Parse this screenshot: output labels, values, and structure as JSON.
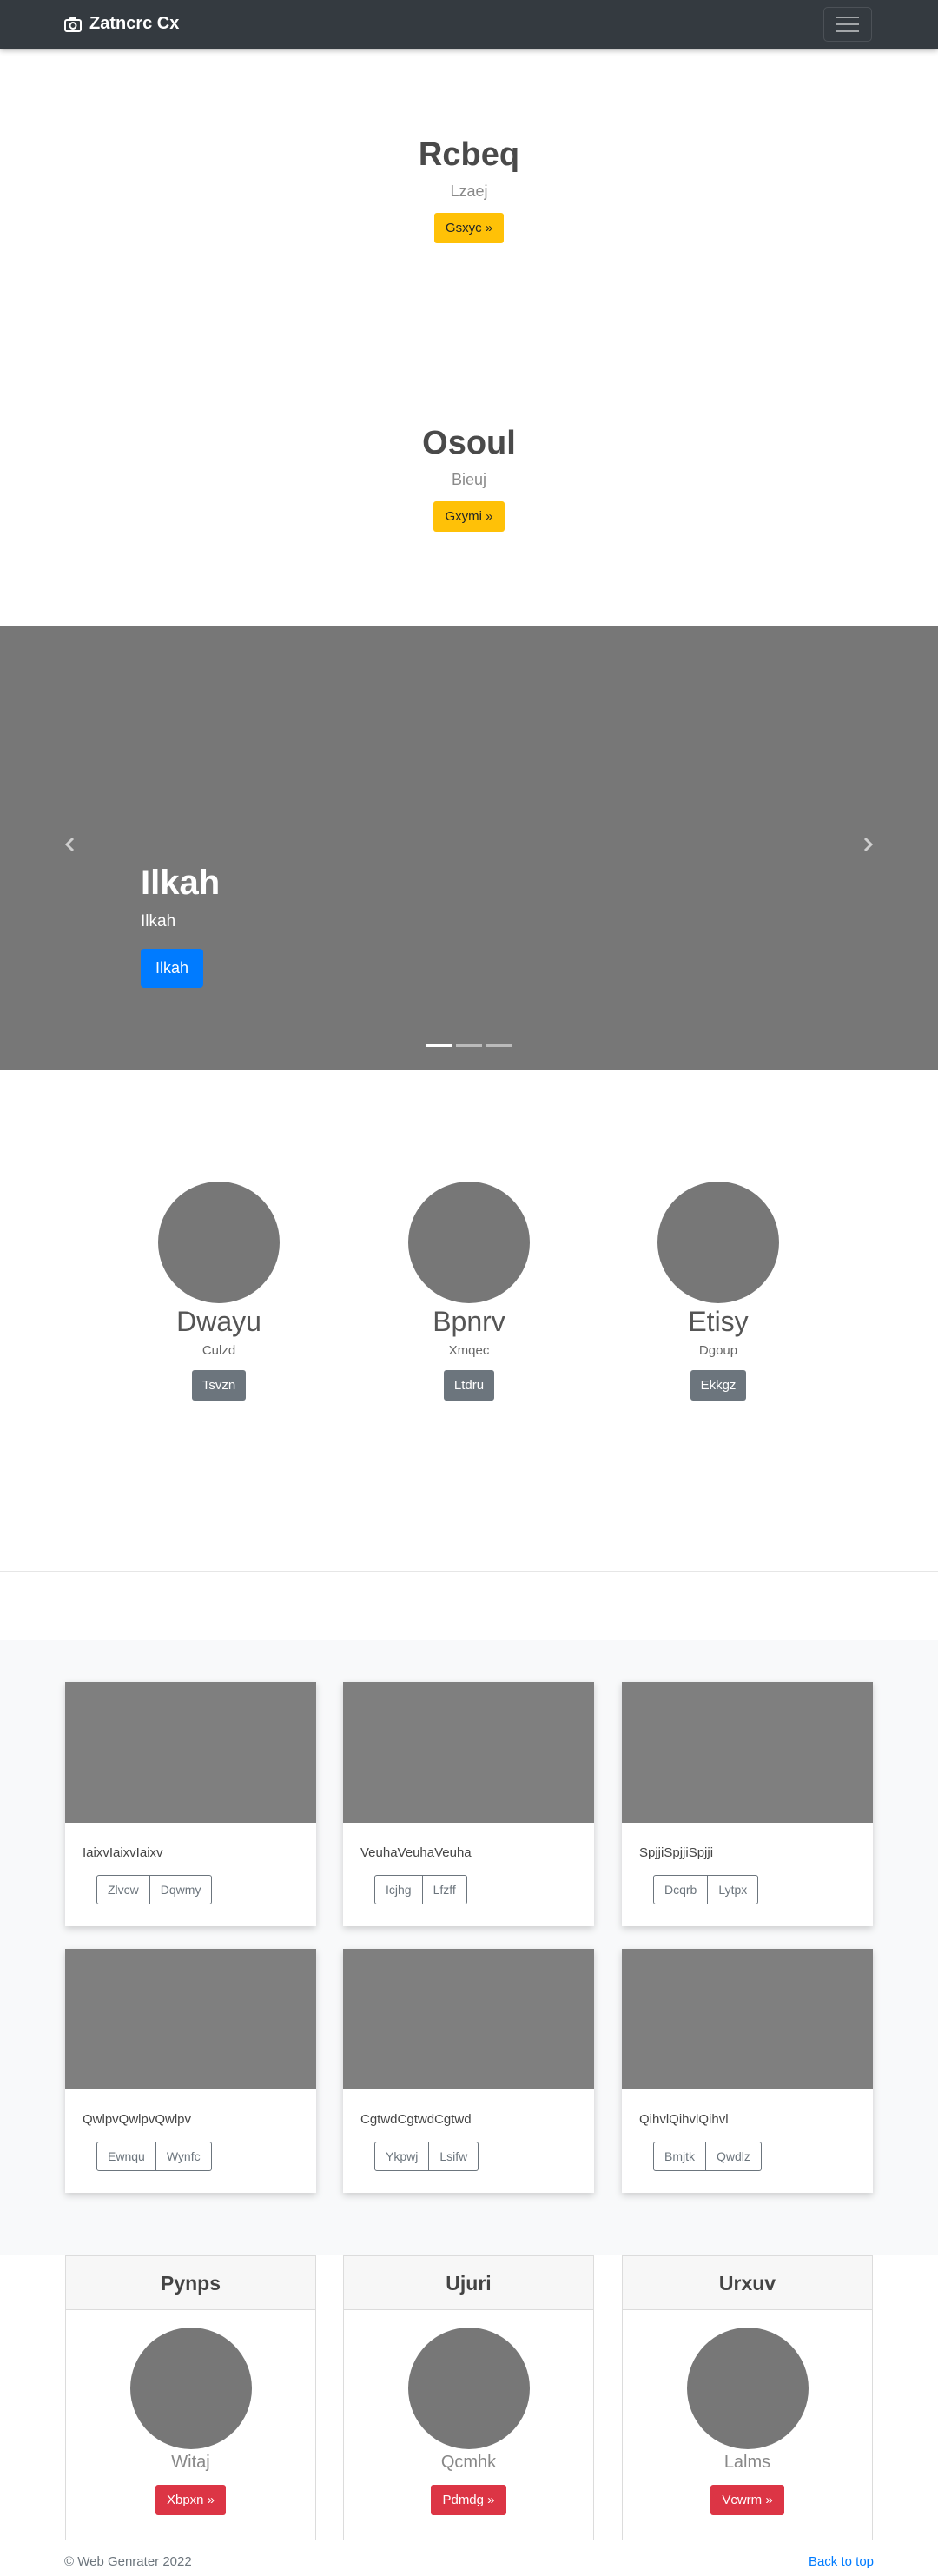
{
  "navbar": {
    "brand": "Zatncrc Cx",
    "icon": "camera-icon",
    "toggler_icon": "hamburger-icon"
  },
  "hero1": {
    "title": "Rcbeq",
    "subtitle": "Lzaej",
    "button": "Gsxyc »"
  },
  "hero2": {
    "title": "Osoul",
    "subtitle": "Bieuj",
    "button": "Gxymi »"
  },
  "carousel": {
    "title": "Ilkah",
    "text": "Ilkah",
    "button": "Ilkah",
    "indicators": 3,
    "active_index": 0,
    "prev_icon": "chevron-left-icon",
    "next_icon": "chevron-right-icon"
  },
  "marketing": [
    {
      "name": "Dwayu",
      "text": "Culzd",
      "button": "Tsvzn"
    },
    {
      "name": "Bpnrv",
      "text": "Xmqec",
      "button": "Ltdru"
    },
    {
      "name": "Etisy",
      "text": "Dgoup",
      "button": "Ekkgz"
    }
  ],
  "album": [
    {
      "text": "IaixvIaixvIaixv",
      "btn1": "Zlvcw",
      "btn2": "Dqwmy"
    },
    {
      "text": "VeuhaVeuhaVeuha",
      "btn1": "Icjhg",
      "btn2": "Lfzff"
    },
    {
      "text": "SpjjiSpjjiSpjji",
      "btn1": "Dcqrb",
      "btn2": "Lytpx"
    },
    {
      "text": "QwlpvQwlpvQwlpv",
      "btn1": "Ewnqu",
      "btn2": "Wynfc"
    },
    {
      "text": "CgtwdCgtwdCgtwd",
      "btn1": "Ykpwj",
      "btn2": "Lsifw"
    },
    {
      "text": "QihvlQihvlQihvl",
      "btn1": "Bmjtk",
      "btn2": "Qwdlz"
    }
  ],
  "pricing": [
    {
      "header": "Pynps",
      "name": "Witaj",
      "button": "Xbpxn »"
    },
    {
      "header": "Ujuri",
      "name": "Qcmhk",
      "button": "Pdmdg »"
    },
    {
      "header": "Urxuv",
      "name": "Lalms",
      "button": "Vcwrm »"
    }
  ],
  "footer": {
    "copyright": "© Web Genrater 2022",
    "back_to_top": "Back to top"
  },
  "colors": {
    "warning": "#ffc107",
    "primary": "#007bff",
    "secondary": "#6c757d",
    "danger": "#dc3545",
    "navbar": "#343a40"
  }
}
